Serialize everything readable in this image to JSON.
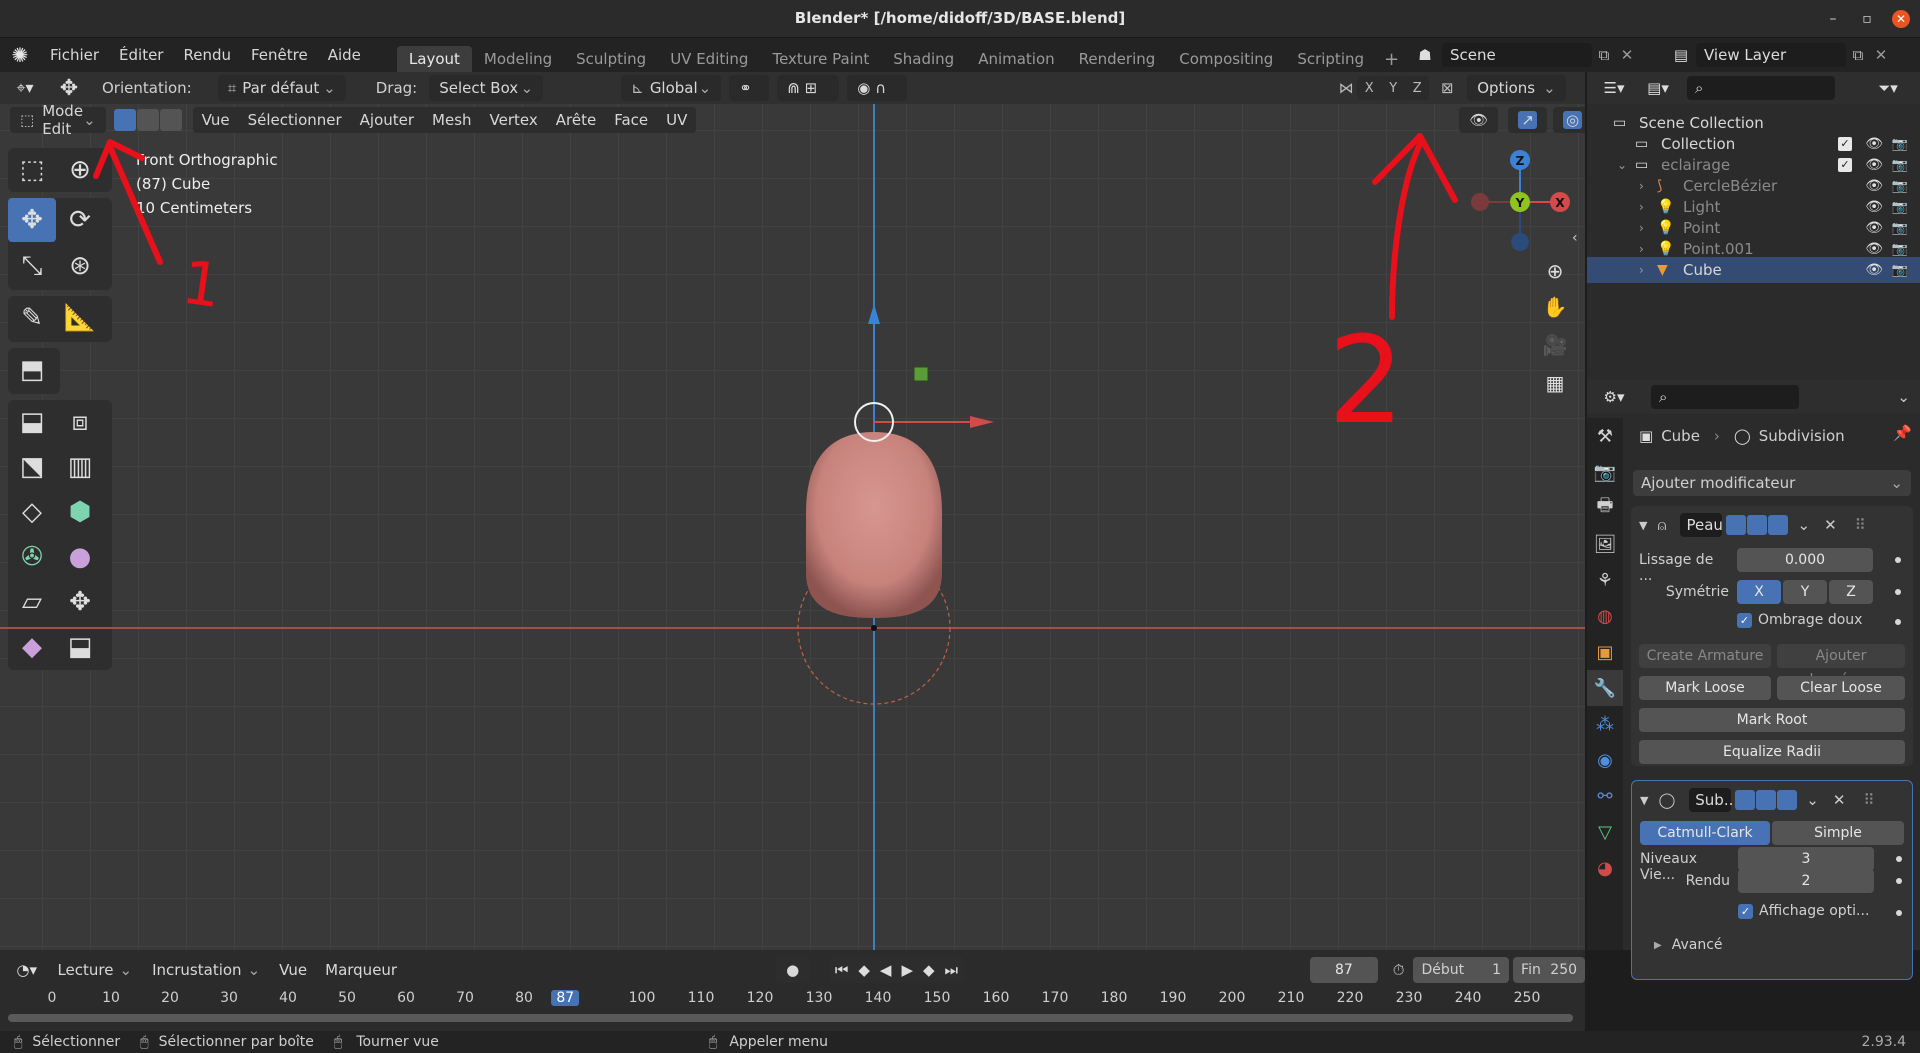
{
  "window": {
    "title": "Blender* [/home/didoff/3D/BASE.blend]"
  },
  "menu": [
    "Fichier",
    "Éditer",
    "Rendu",
    "Fenêtre",
    "Aide"
  ],
  "workspaces": [
    "Layout",
    "Modeling",
    "Sculpting",
    "UV Editing",
    "Texture Paint",
    "Shading",
    "Animation",
    "Rendering",
    "Compositing",
    "Scripting"
  ],
  "active_workspace": "Layout",
  "scene": {
    "name": "Scene",
    "view_layer": "View Layer"
  },
  "tool_header": {
    "orientation_label": "Orientation:",
    "orientation_value": "Par défaut",
    "drag_label": "Drag:",
    "drag_value": "Select Box",
    "transform_orientation": "Global",
    "axes": [
      "X",
      "Y",
      "Z"
    ],
    "options_label": "Options"
  },
  "view_header": {
    "mode": "Mode Edit",
    "menus": [
      "Vue",
      "Sélectionner",
      "Ajouter",
      "Mesh",
      "Vertex",
      "Arête",
      "Face",
      "UV"
    ]
  },
  "viewport_info": {
    "line1": "Front Orthographic",
    "line2": "(87) Cube",
    "line3": "10 Centimeters"
  },
  "gizmo_axes": {
    "z": "Z",
    "y": "Y",
    "x": "X"
  },
  "annotations": {
    "arrow1_label": "1",
    "arrow2_label": "2",
    "color": "#e8101a"
  },
  "outliner": {
    "items": [
      {
        "label": "Scene Collection",
        "depth": 0,
        "icon": "scene-collection-icon"
      },
      {
        "label": "Collection",
        "depth": 1,
        "icon": "collection-icon",
        "checked": true
      },
      {
        "label": "eclairage",
        "depth": 1,
        "icon": "collection-icon",
        "checked": true,
        "dim": true
      },
      {
        "label": "CercleBézier",
        "depth": 2,
        "icon": "curve-icon",
        "dim": true
      },
      {
        "label": "Light",
        "depth": 2,
        "icon": "light-icon",
        "dim": true
      },
      {
        "label": "Point",
        "depth": 2,
        "icon": "light-icon",
        "dim": true
      },
      {
        "label": "Point.001",
        "depth": 2,
        "icon": "light-icon",
        "dim": true
      },
      {
        "label": "Cube",
        "depth": 2,
        "icon": "mesh-icon",
        "selected": true
      }
    ]
  },
  "properties": {
    "breadcrumb_object": "Cube",
    "breadcrumb_modifier": "Subdivision",
    "add_modifier": "Ajouter modificateur",
    "skin": {
      "name": "Peau",
      "smoothing_label": "Lissage de ...",
      "smoothing_value": "0.000",
      "symmetry_label": "Symétrie",
      "symmetry_axes": [
        "X",
        "Y",
        "Z"
      ],
      "smooth_shading_label": "Ombrage doux",
      "create_armature": "Create Armature",
      "add_data": "Ajouter données...",
      "mark_loose": "Mark Loose",
      "clear_loose": "Clear Loose",
      "mark_root": "Mark Root",
      "equalize_radii": "Equalize Radii"
    },
    "subsurf": {
      "name": "Sub...",
      "catmull": "Catmull-Clark",
      "simple": "Simple",
      "levels_view_label": "Niveaux Vie...",
      "levels_view": "3",
      "render_label": "Rendu",
      "render_value": "2",
      "optimal_display_label": "Affichage opti...",
      "advanced_label": "Avancé"
    }
  },
  "timeline": {
    "menus": [
      "Lecture",
      "Incrustation",
      "Vue",
      "Marqueur"
    ],
    "current_frame": "87",
    "start_label": "Début",
    "start": "1",
    "end_label": "Fin",
    "end": "250",
    "ticks": [
      "0",
      "10",
      "20",
      "30",
      "40",
      "50",
      "60",
      "70",
      "80",
      "87",
      "100",
      "110",
      "120",
      "130",
      "140",
      "150",
      "160",
      "170",
      "180",
      "190",
      "200",
      "210",
      "220",
      "230",
      "240",
      "250"
    ]
  },
  "statusbar": {
    "select": "Sélectionner",
    "box_select": "Sélectionner par boîte",
    "rotate_view": "Tourner vue",
    "call_menu": "Appeler menu",
    "version": "2.93.4"
  }
}
